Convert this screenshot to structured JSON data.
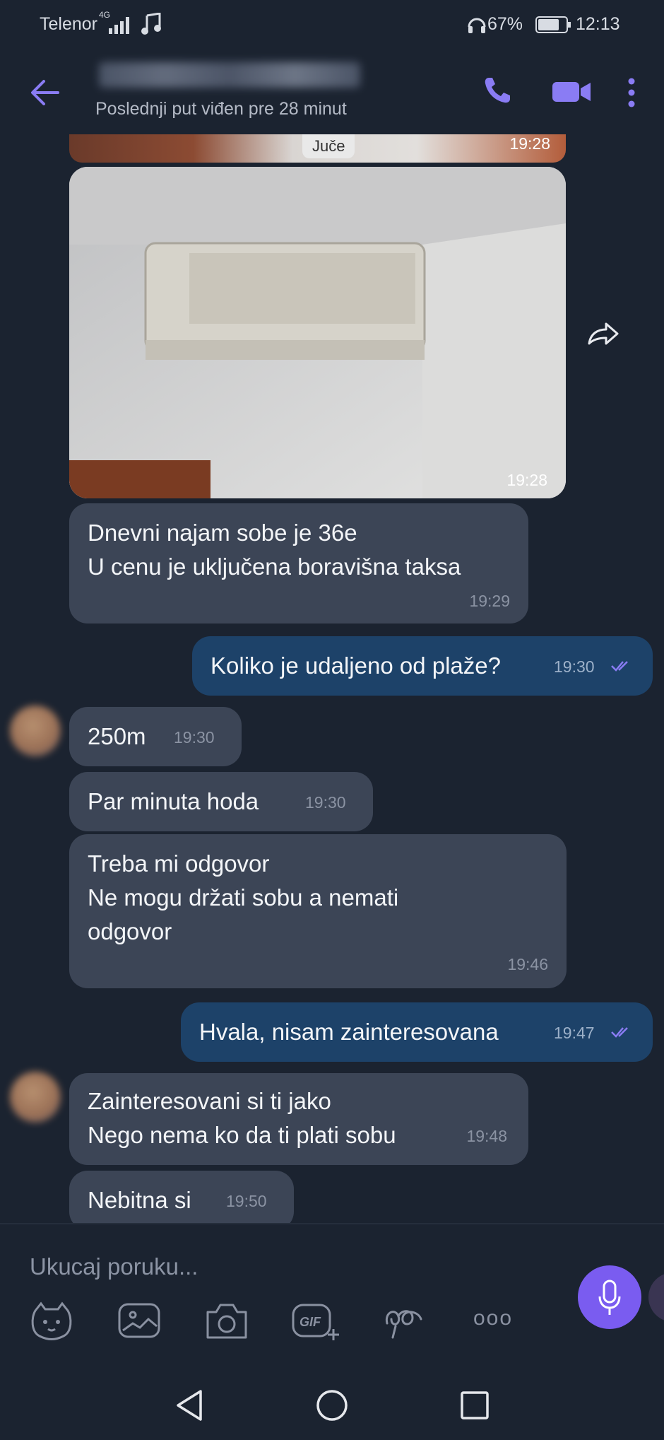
{
  "status_bar": {
    "carrier": "Telenor",
    "network": "4G",
    "battery": "67%",
    "time": "12:13"
  },
  "header": {
    "last_seen": "Poslednji put viđen pre 28 minut"
  },
  "top_preview": {
    "label": "Juče",
    "time": "19:28"
  },
  "photo": {
    "time": "19:28"
  },
  "messages": [
    {
      "dir": "in",
      "text": "Dnevni najam sobe je 36e\nU cenu je uključena boravišna taksa",
      "time": "19:29"
    },
    {
      "dir": "out",
      "text": "Koliko je udaljeno od plaže?",
      "time": "19:30"
    },
    {
      "dir": "in",
      "text": "250m",
      "time": "19:30"
    },
    {
      "dir": "in",
      "text": "Par minuta hoda",
      "time": "19:30"
    },
    {
      "dir": "in",
      "text": "Treba mi odgovor\nNe mogu držati sobu a nemati\nodgovor",
      "time": "19:46"
    },
    {
      "dir": "out",
      "text": "Hvala, nisam zainteresovana",
      "time": "19:47"
    },
    {
      "dir": "in",
      "text": "Zainteresovani si ti jako\nNego nema ko da ti plati sobu",
      "time": "19:48"
    },
    {
      "dir": "in",
      "text": "Nebitna si",
      "time": "19:50"
    }
  ],
  "composer": {
    "placeholder": "Ukucaj poruku...",
    "gif_label": "GIF",
    "more_label": "ooo"
  },
  "icons": [
    "back-arrow-icon",
    "phone-icon",
    "video-icon",
    "more-vert-icon",
    "share-icon",
    "sticker-icon",
    "gallery-icon",
    "camera-icon",
    "gif-icon",
    "doodle-icon",
    "more-icon",
    "mic-icon"
  ],
  "colors": {
    "background": "#1b2330",
    "incoming": "#3c4556",
    "outgoing": "#1d4269",
    "accent": "#7a5cf0"
  }
}
